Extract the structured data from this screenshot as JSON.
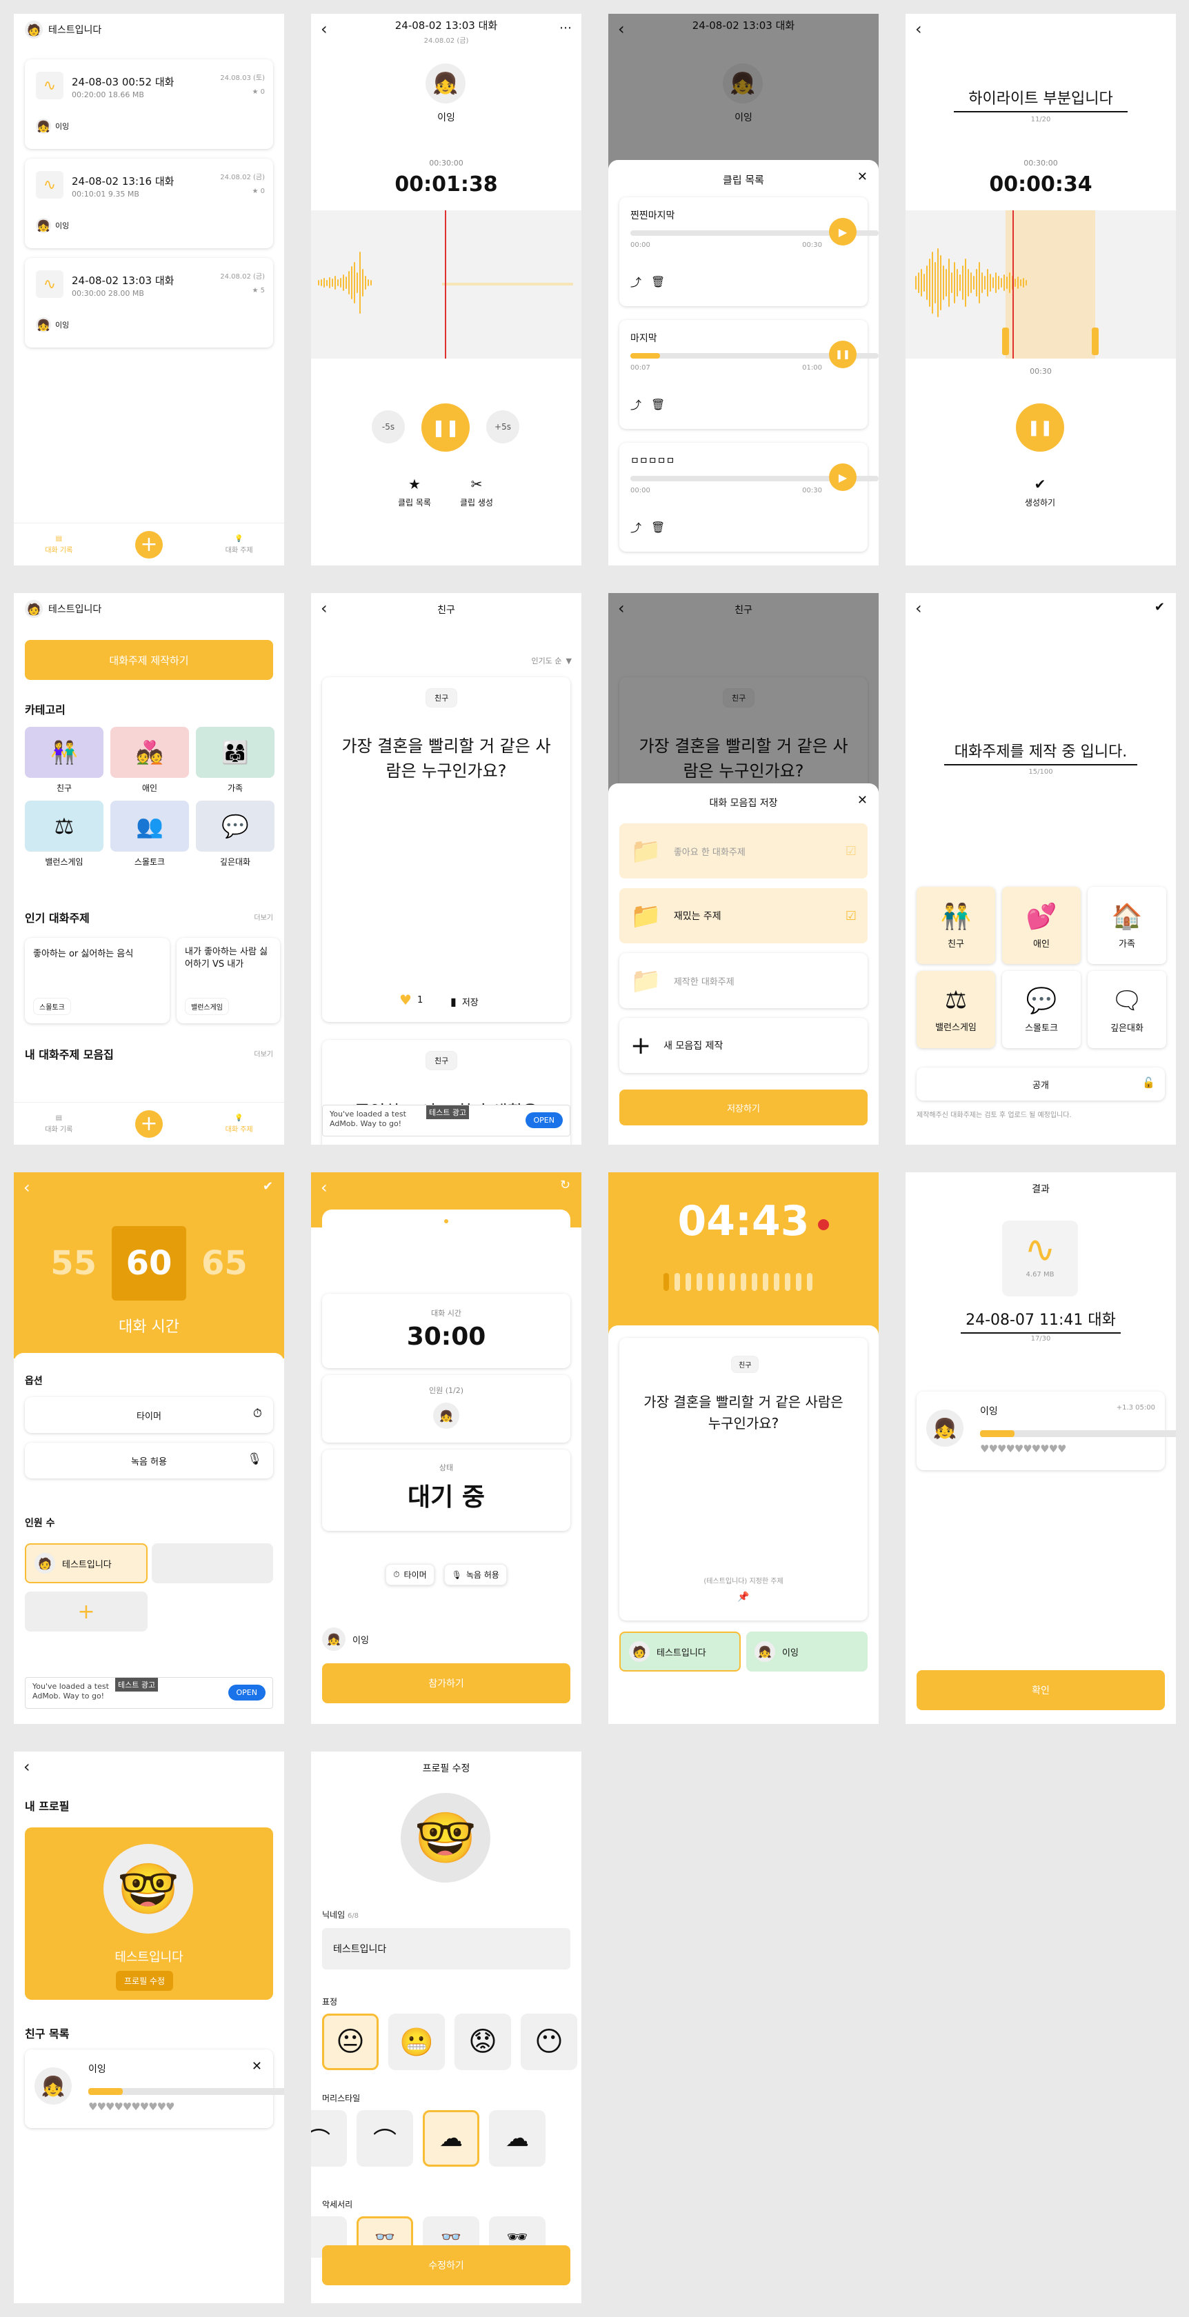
{
  "user": {
    "name": "테스트입니다",
    "friend": "이잉"
  },
  "s1": {
    "records": [
      {
        "title": "24-08-03 00:52 대화",
        "date": "24.08.03 (토)",
        "meta": "00:20:00   18.66 MB",
        "stars": "★ 0"
      },
      {
        "title": "24-08-02 13:16 대화",
        "date": "24.08.02 (금)",
        "meta": "00:10:01   9.35 MB",
        "stars": "★ 0"
      },
      {
        "title": "24-08-02 13:03 대화",
        "date": "24.08.02 (금)",
        "meta": "00:30:00   28.00 MB",
        "stars": "★ 5"
      }
    ],
    "nav_left": "대화 기록",
    "nav_right": "대화 주제"
  },
  "s2": {
    "title": "24-08-02 13:03 대화",
    "date": "24.08.02 (금)",
    "total": "00:30:00",
    "current": "00:01:38",
    "minus": "-5s",
    "plus": "+5s",
    "clip_list": "클립 목록",
    "clip_make": "클립 생성"
  },
  "s3": {
    "sheet_title": "클립 목록",
    "clips": [
      {
        "name": "찐찐마지막",
        "start": "00:00",
        "end": "00:30",
        "progress": 0,
        "playing": false
      },
      {
        "name": "마지막",
        "start": "00:07",
        "end": "01:00",
        "progress": 0.12,
        "playing": true
      },
      {
        "name": "ㅁㅁㅁㅁㅁ",
        "start": "00:00",
        "end": "00:30",
        "progress": 0,
        "playing": false
      }
    ]
  },
  "s4": {
    "title": "하이라이트 부분입니다",
    "count": "11/20",
    "total": "00:30:00",
    "current": "00:00:34",
    "clip_len": "00:30",
    "create": "생성하기"
  },
  "s5": {
    "make_btn": "대화주제 제작하기",
    "category_h": "카테고리",
    "categories": [
      "친구",
      "애인",
      "가족",
      "밸런스게임",
      "스몰토크",
      "깊은대화"
    ],
    "popular_h": "인기 대화주제",
    "more": "더보기",
    "popular": [
      {
        "text": "좋아하는 or 싫어하는 음식",
        "tag": "스몰토크"
      },
      {
        "text": "내가 좋아하는 사람 싫어하기 VS 내가",
        "tag": "밸런스게임"
      }
    ],
    "mine_h": "내 대화주제 모음집"
  },
  "s6": {
    "title": "친구",
    "sort": "인기도 순",
    "tag": "친구",
    "question": "가장 결혼을 빨리할 거 같은 사람은 누구인가요?",
    "likes": "1",
    "save": "저장",
    "tag2": "친구",
    "question2": "졸업하고 어느 회사 생활을",
    "ad": "You've loaded a test AdMob. Way to go!",
    "ad_badge": "테스트 광고",
    "ad_open": "OPEN"
  },
  "s7": {
    "sheet_title": "대화 모음집 저장",
    "items": [
      {
        "label": "좋아요 한 대화주제",
        "checked": true
      },
      {
        "label": "재밌는 주제",
        "checked": true
      },
      {
        "label": "제작한 대화주제",
        "checked": false
      }
    ],
    "new_label": "새 모음집 제작",
    "save": "저장하기"
  },
  "s8": {
    "title": "대화주제를 제작 중 입니다.",
    "count": "15/100",
    "public": "공개",
    "note": "제작해주신 대화주제는 검토 후 업로드 될 예정입니다."
  },
  "s9": {
    "nums": [
      "55",
      "60",
      "65"
    ],
    "label": "대화 시간",
    "options_h": "옵션",
    "timer": "타이머",
    "record": "녹음 허용",
    "people_h": "인원 수",
    "ad": "You've loaded a test AdMob. Way to go!",
    "ad_badge": "테스트 광고",
    "ad_open": "OPEN"
  },
  "s10": {
    "time_l": "대화 시간",
    "time": "30:00",
    "people_l": "인원 (1/2)",
    "state_l": "상태",
    "state": "대기 중",
    "timer": "타이머",
    "record": "녹음 허용",
    "join": "참가하기"
  },
  "s11": {
    "time": "04:43",
    "tag": "친구",
    "question": "가장 결혼을 빨리할 거 같은 사람은 누구인가요?",
    "author": "(테스트입니다) 지정한 주제"
  },
  "s12": {
    "title": "결과",
    "size": "4.67 MB",
    "name": "24-08-07 11:41 대화",
    "count": "17/30",
    "stat": "+1.3   05:00",
    "confirm": "확인"
  },
  "s13": {
    "my_h": "내 프로필",
    "edit": "프로필 수정",
    "friends_h": "친구 목록"
  },
  "s14": {
    "title": "프로필 수정",
    "nick_l": "닉네임",
    "nick_c": "6/8",
    "expr": "표정",
    "hair": "머리스타일",
    "acc": "악세서리",
    "submit": "수정하기"
  }
}
